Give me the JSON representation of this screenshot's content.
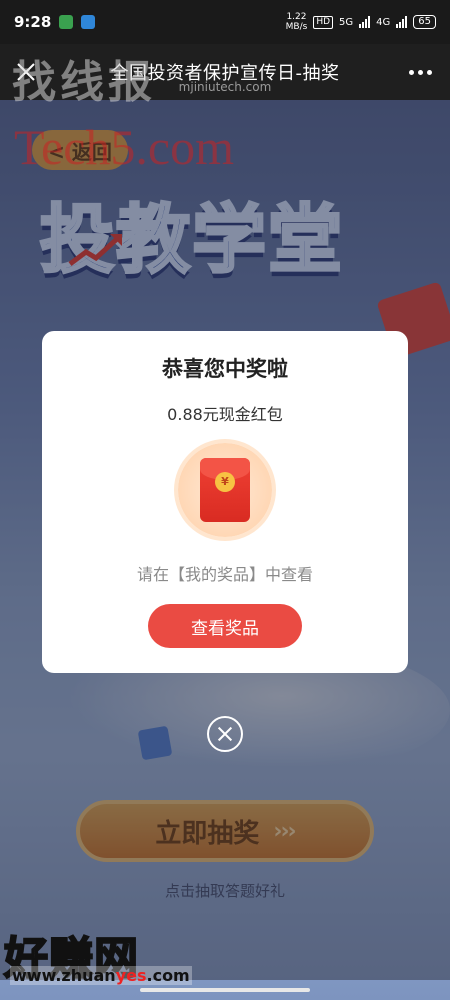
{
  "status_bar": {
    "time": "9:28",
    "net_speed_value": "1.22",
    "net_speed_unit": "MB/s",
    "hd_badge": "HD",
    "signal_1": "5G",
    "signal_2": "4G",
    "battery": "65"
  },
  "nav": {
    "title": "全国投资者保护宣传日-抽奖",
    "url": "mjiniutech.com"
  },
  "watermark": {
    "top": "找线报",
    "tech": "Tech5.com",
    "bottom": "好赚网",
    "bottom_url_pre": "www.zhuan",
    "bottom_url_hl": "yes",
    "bottom_url_post": ".com"
  },
  "page": {
    "back_label": "< 返回",
    "hero_title": "投教学堂",
    "draw_button_label": "立即抽奖",
    "draw_chevrons": "›››",
    "draw_hint": "点击抽取答题好礼"
  },
  "modal": {
    "title": "恭喜您中奖啦",
    "prize": "0.88元现金红包",
    "coin_symbol": "¥",
    "tip": "请在【我的奖品】中查看",
    "view_button": "查看奖品"
  },
  "colors": {
    "accent_red": "#ea4b43",
    "gold_button": "#d9a253",
    "hero_blue": "#2e4fa8"
  }
}
